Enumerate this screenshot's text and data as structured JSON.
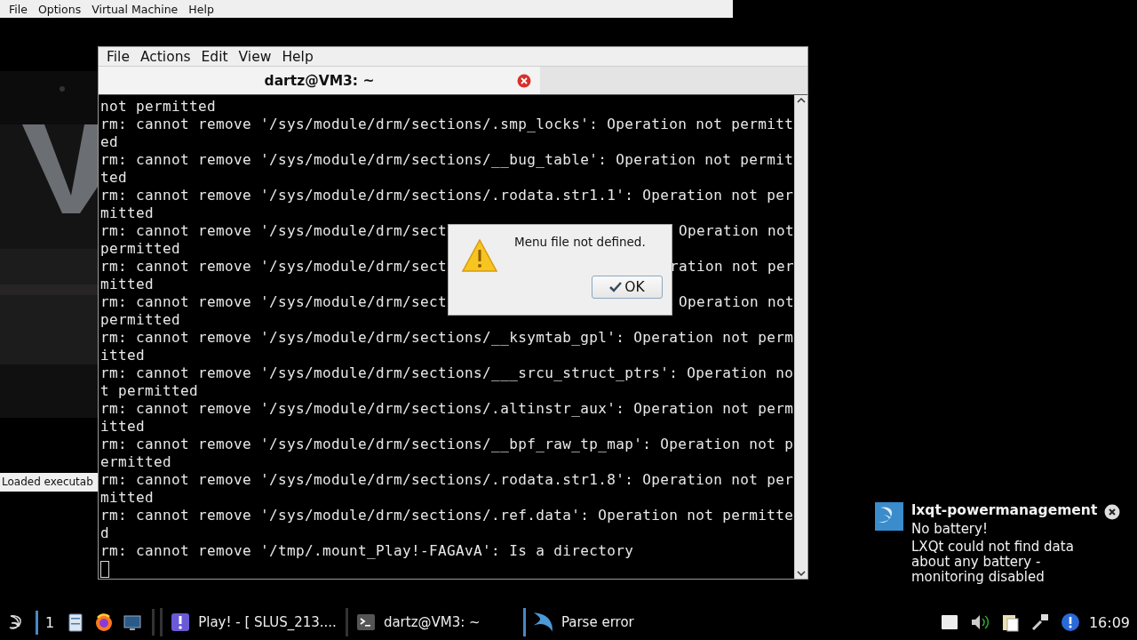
{
  "emulator_window": {
    "menu": [
      "File",
      "Options",
      "Virtual Machine",
      "Help"
    ],
    "status": "Loaded executab"
  },
  "terminal_window": {
    "menu": [
      "File",
      "Actions",
      "Edit",
      "View",
      "Help"
    ],
    "tab": {
      "title": "dartz@VM3: ~"
    },
    "lines": [
      {
        "text": "not permitted"
      },
      {
        "text": "rm: cannot remove '/sys/module/drm/sections/.smp_locks': Operation not permitt"
      },
      {
        "text": "ed"
      },
      {
        "text": "rm: cannot remove '/sys/module/drm/sections/__bug_table': Operation not permit"
      },
      {
        "text": "ted"
      },
      {
        "text": "rm: cannot remove '/sys/module/drm/sections/.rodata.str1.1': Operation not per"
      },
      {
        "text": "mitted"
      },
      {
        "text": "rm: cannot remove '/sys/module/drm/sect",
        "text_right": "Operation not"
      },
      {
        "text": "permitted"
      },
      {
        "text": "rm: cannot remove '/sys/module/drm/sect",
        "text_right": "ration not per"
      },
      {
        "text": "mitted"
      },
      {
        "text": "rm: cannot remove '/sys/module/drm/sect",
        "text_right": "Operation not"
      },
      {
        "text": "permitted"
      },
      {
        "text": "rm: cannot remove '/sys/module/drm/sections/__ksymtab_gpl': Operation not perm"
      },
      {
        "text": "itted"
      },
      {
        "text": "rm: cannot remove '/sys/module/drm/sections/___srcu_struct_ptrs': Operation no"
      },
      {
        "text": "t permitted"
      },
      {
        "text": "rm: cannot remove '/sys/module/drm/sections/.altinstr_aux': Operation not perm"
      },
      {
        "text": "itted"
      },
      {
        "text": "rm: cannot remove '/sys/module/drm/sections/__bpf_raw_tp_map': Operation not p"
      },
      {
        "text": "ermitted"
      },
      {
        "text": "rm: cannot remove '/sys/module/drm/sections/.rodata.str1.8': Operation not per"
      },
      {
        "text": "mitted"
      },
      {
        "text": "rm: cannot remove '/sys/module/drm/sections/.ref.data': Operation not permitte"
      },
      {
        "text": "d"
      },
      {
        "text": "rm: cannot remove '/tmp/.mount_Play!-FAGAvA': Is a directory"
      }
    ]
  },
  "dialog": {
    "message": "Menu file not defined.",
    "button": "OK"
  },
  "notification": {
    "title": "lxqt-powermanagement",
    "summary": "No battery!",
    "body": "LXQt could not find data about any battery - monitoring disabled"
  },
  "taskbar": {
    "desktops": [
      {
        "label": "1",
        "selected": true
      }
    ],
    "tasks": [
      {
        "title": "Play! - [ SLUS_213....",
        "kind": "emulator",
        "selected": false
      },
      {
        "title": "dartz@VM3: ~",
        "kind": "terminal",
        "selected": false
      },
      {
        "title": "Parse error",
        "kind": "lxqt",
        "selected": true
      }
    ],
    "clock": "16:09"
  }
}
